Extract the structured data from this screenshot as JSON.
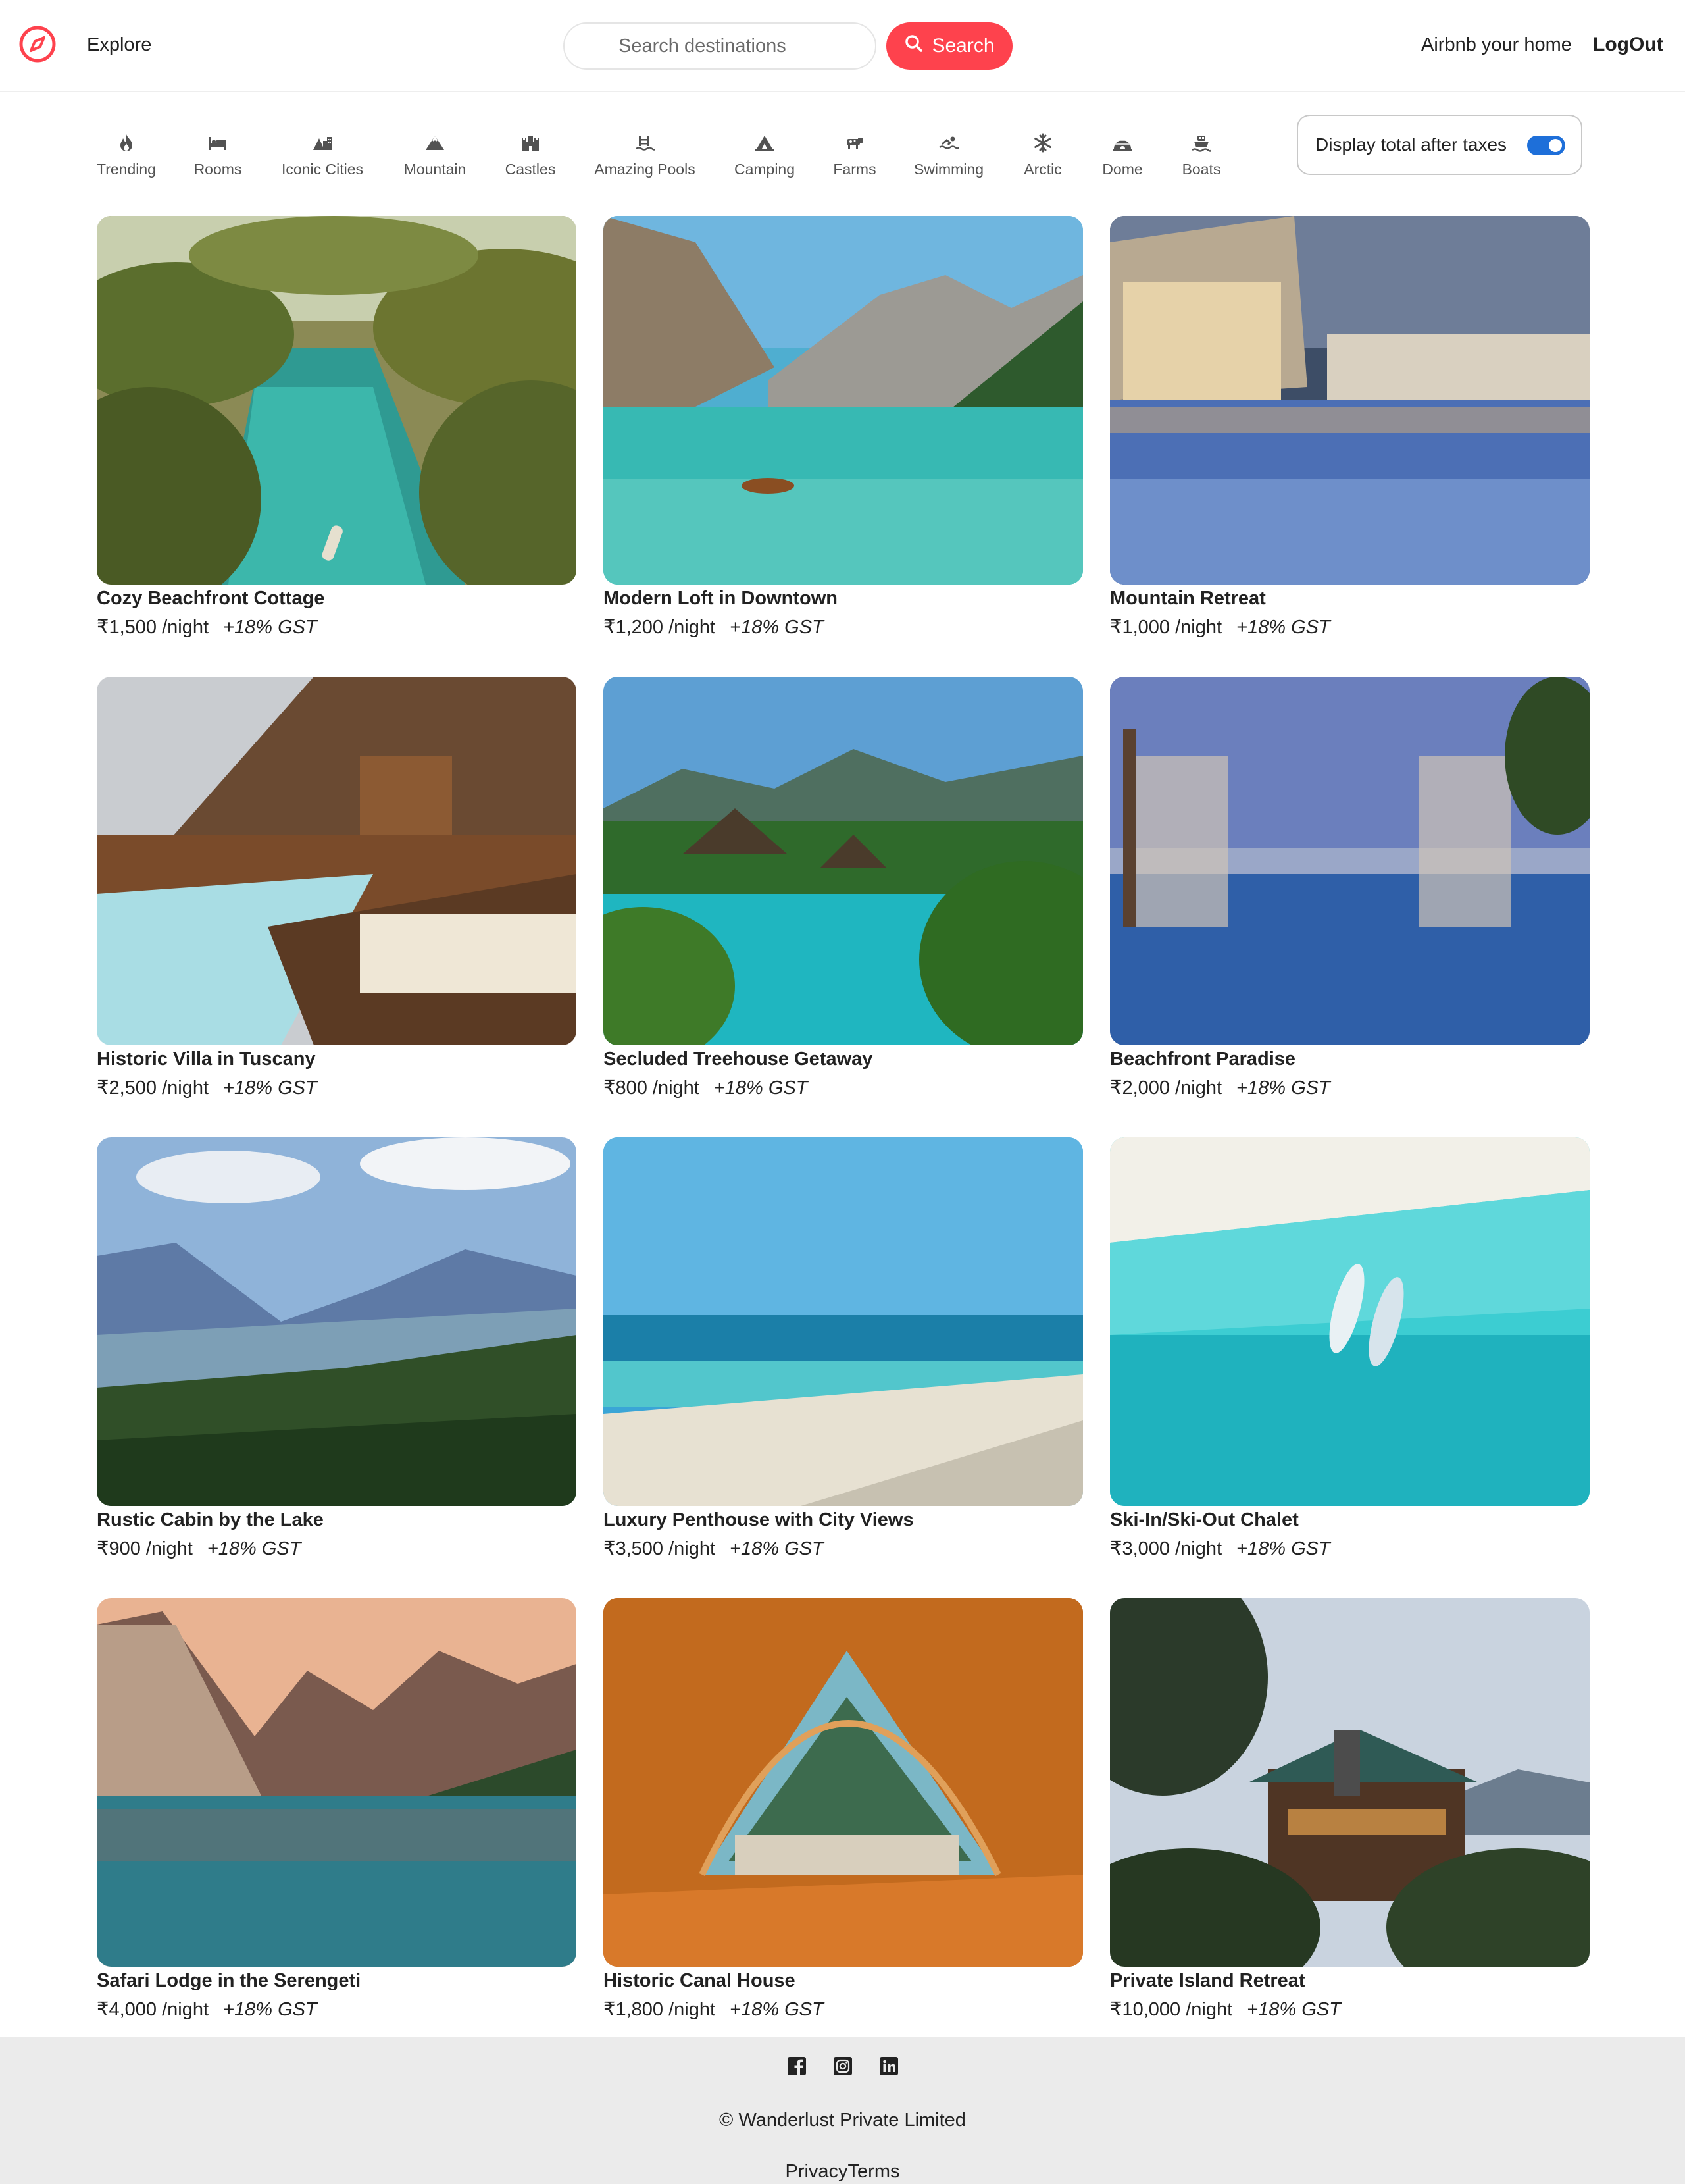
{
  "nav": {
    "explore_label": "Explore",
    "search_placeholder": "Search destinations",
    "search_button": "Search",
    "host_link": "Airbnb your home",
    "logout": "LogOut"
  },
  "filters": [
    {
      "label": "Trending",
      "icon": "fire-icon"
    },
    {
      "label": "Rooms",
      "icon": "bed-icon"
    },
    {
      "label": "Iconic Cities",
      "icon": "mountain-city-icon"
    },
    {
      "label": "Mountain",
      "icon": "mountain-icon"
    },
    {
      "label": "Castles",
      "icon": "castle-icon"
    },
    {
      "label": "Amazing Pools",
      "icon": "person-swimming-pool-icon"
    },
    {
      "label": "Camping",
      "icon": "campground-icon"
    },
    {
      "label": "Farms",
      "icon": "cow-icon"
    },
    {
      "label": "Swimming",
      "icon": "person-swimming-icon"
    },
    {
      "label": "Arctic",
      "icon": "snowflake-icon"
    },
    {
      "label": "Dome",
      "icon": "igloo-icon"
    },
    {
      "label": "Boats",
      "icon": "ferry-icon"
    }
  ],
  "tax_toggle": {
    "label": "Display total after taxes",
    "enabled": true
  },
  "currency_symbol": "₹",
  "gst_label": "+18% GST",
  "listings": [
    {
      "title": "Cozy Beachfront Cottage",
      "price": "₹1,500 /night",
      "image": "tropical-river-boat"
    },
    {
      "title": "Modern Loft in Downtown",
      "price": "₹1,200 /night",
      "image": "mountain-lake-boat"
    },
    {
      "title": "Mountain Retreat",
      "price": "₹1,000 /night",
      "image": "resort-pool-evening"
    },
    {
      "title": "Historic Villa in Tuscany",
      "price": "₹2,500 /night",
      "image": "wooden-lodge-pool"
    },
    {
      "title": "Secluded Treehouse Getaway",
      "price": "₹800 /night",
      "image": "tropical-resort-pool"
    },
    {
      "title": "Beachfront Paradise",
      "price": "₹2,000 /night",
      "image": "infinity-pool-cabanas"
    },
    {
      "title": "Rustic Cabin by the Lake",
      "price": "₹900 /night",
      "image": "mountain-valley-forest"
    },
    {
      "title": "Luxury Penthouse with City Views",
      "price": "₹3,500 /night",
      "image": "sandy-beach-sea"
    },
    {
      "title": "Ski-In/Ski-Out Chalet",
      "price": "₹3,000 /night",
      "image": "aerial-turquoise-boats"
    },
    {
      "title": "Safari Lodge in the Serengeti",
      "price": "₹4,000 /night",
      "image": "alpine-lake-sunset"
    },
    {
      "title": "Historic Canal House",
      "price": "₹1,800 /night",
      "image": "tent-forest-view"
    },
    {
      "title": "Private Island Retreat",
      "price": "₹10,000 /night",
      "image": "forest-cabin-dusk"
    }
  ],
  "footer": {
    "socials": [
      "facebook-icon",
      "instagram-icon",
      "linkedin-icon"
    ],
    "copyright": "© Wanderlust Private Limited",
    "links": "PrivacyTerms"
  },
  "colors": {
    "brand": "#fe424d",
    "toggle": "#1e6fd9",
    "footer_bg": "#ebebeb"
  }
}
